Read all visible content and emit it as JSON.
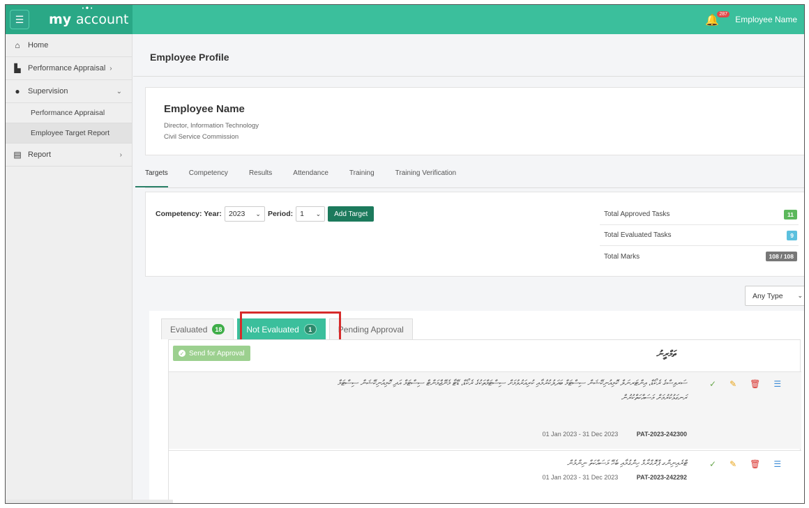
{
  "header": {
    "logo_main": "my",
    "logo_light": "account",
    "notification_count": "287",
    "user_name": "Employee Name"
  },
  "sidebar": {
    "items": [
      {
        "label": "Home",
        "icon": "home-icon"
      },
      {
        "label": "Performance Appraisal",
        "icon": "chart-icon"
      },
      {
        "label": "Supervision",
        "icon": "user-icon"
      },
      {
        "label": "Report",
        "icon": "document-icon"
      }
    ],
    "sub_items": [
      "Performance Appraisal",
      "Employee Target Report"
    ]
  },
  "page": {
    "title": "Employee Profile"
  },
  "profile": {
    "name": "Employee Name",
    "position": "Director, Information Technology",
    "department": "Civil Service Commission"
  },
  "tabs": [
    "Targets",
    "Competency",
    "Results",
    "Attendance",
    "Training",
    "Training Verification"
  ],
  "filter": {
    "label_year": "Competency: Year:",
    "year": "2023",
    "label_period": "Period:",
    "period": "1",
    "add_target": "Add Target"
  },
  "stats": [
    {
      "label": "Total Approved Tasks",
      "value": "11",
      "color": "#5cb85c"
    },
    {
      "label": "Total Evaluated Tasks",
      "value": "9",
      "color": "#5bc0de"
    },
    {
      "label": "Total Marks",
      "value": "108 / 108",
      "color": "#777777"
    }
  ],
  "type_filter": "Any Type",
  "list_tabs": [
    {
      "label": "Evaluated",
      "count": "18"
    },
    {
      "label": "Not Evaluated",
      "count": "1"
    },
    {
      "label": "Pending Approval",
      "count": ""
    }
  ],
  "send_for_approval": "Send for Approval",
  "section_title": "ތަމްރީނު",
  "rows": [
    {
      "text": "ސަރވިސްގެ ރެކޯޑް، އިންޓަރނަލް ކޮމިއުނިކޭޝަން ސިސްޓަމް ބަދަލުކުރުމާއި ކުރިއަރުވުމަށް ސިސްޓަމްތަކުގެ ރެކޯޑް، ޑޭޓާ މެނޭޖްމަންޓް ސިސްޓަމް އަދި ކޮމިއުނިކޭޝަން ސިސްޓަމް ރަނގަޅުކުރުމަށް މަސައްކަތްކުރުން",
      "dates": "01 Jan 2023 - 31 Dec 2023",
      "code": "PAT-2023-242300"
    },
    {
      "text": "ޓްރެއިނިންގ ޕްރޮގްރާމް ހިންގުމާއި ބެހޭ މަސައްކަތް ނިންމުން",
      "dates": "01 Jan 2023 - 31 Dec 2023",
      "code": "PAT-2023-242292"
    }
  ]
}
